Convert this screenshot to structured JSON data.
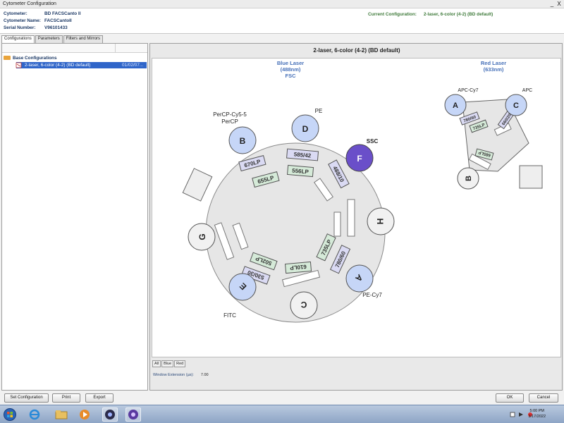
{
  "window": {
    "title": "Cytometer Configuration",
    "minimize": "_",
    "close": "X"
  },
  "info": {
    "cytometer_label": "Cytometer:",
    "cytometer_value": "BD FACSCanto II",
    "name_label": "Cytometer Name:",
    "name_value": "FACSCantoII",
    "serial_label": "Serial Number:",
    "serial_value": "V96101433",
    "current_label": "Current Configuration:",
    "current_value": "2-laser, 6-color (4-2) (BD default)"
  },
  "tabs": [
    "Configurations",
    "Parameters",
    "Filters and Mirrors"
  ],
  "tree": {
    "root": "Base Configurations",
    "item": "2-laser, 6-color (4-2) (BD default)",
    "item_date": "01/02/07..."
  },
  "config_title": "2-laser, 6-color (4-2) (BD default)",
  "blue_laser": {
    "title": "Blue Laser",
    "wavelength": "(488nm)",
    "extra": "FSC"
  },
  "red_laser": {
    "title": "Red Laser",
    "wavelength": "(633nm)"
  },
  "blue_detectors": {
    "B": "B",
    "D": "D",
    "F": "F",
    "H": "H",
    "A": "A",
    "C": "C",
    "E": "E",
    "G": "G",
    "label_B1": "PerCP-Cy5-5",
    "label_B2": "PerCP",
    "label_D": "PE",
    "label_F": "SSC",
    "label_A": "PE-Cy7",
    "label_E": "FITC"
  },
  "blue_filters": {
    "f670LP": "670LP",
    "f655LP": "655LP",
    "f585_42": "585/42",
    "f556LP": "556LP",
    "f488_10": "488/10",
    "f735LP": "735LP",
    "f780_60": "780/60",
    "f610LP": "610LP",
    "f502LP": "502LP",
    "f530_30": "530/30"
  },
  "red_detectors": {
    "A": "A",
    "C": "C",
    "B": "B",
    "label_A": "APC-Cy7",
    "label_C": "APC"
  },
  "red_filters": {
    "f780_60": "780/60",
    "f660_20": "660/20",
    "f735LP": "735LP",
    "f685LP": "685LP"
  },
  "subtabs": [
    "All",
    "Blue",
    "Red"
  ],
  "window_extension": {
    "label": "Window Extension (µs):",
    "value": "7.00"
  },
  "buttons": {
    "set_configuration": "Set Configuration",
    "print": "Print",
    "export": "Export",
    "ok": "OK",
    "cancel": "Cancel"
  },
  "clock": {
    "time": "5:00 PM",
    "date": "3/17/2022"
  },
  "colors": {
    "detector_blue": "#c6d6f7",
    "detector_ssc": "#6a4fc9",
    "filter_green": "#d5ead8",
    "filter_lav": "#dadaf3",
    "selection": "#2f65c9"
  }
}
